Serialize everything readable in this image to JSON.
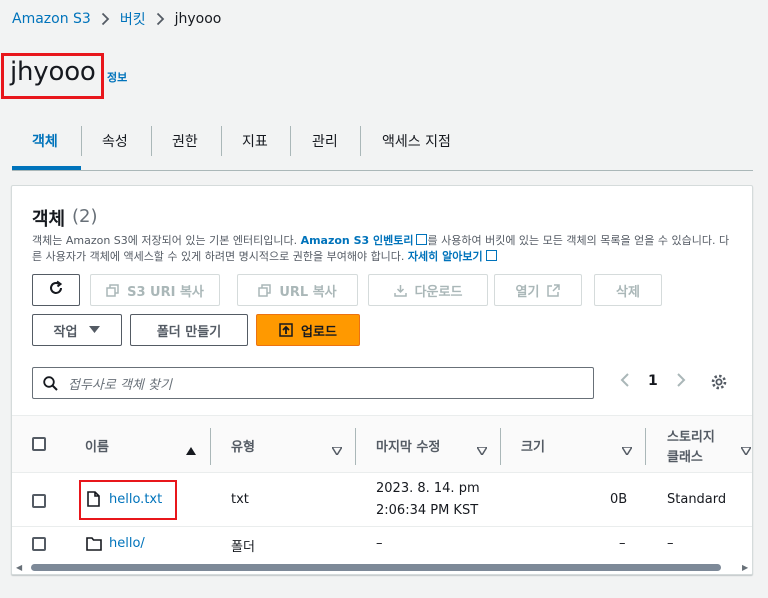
{
  "breadcrumb": {
    "root": "Amazon S3",
    "mid": "버킷",
    "current": "jhyooo"
  },
  "header": {
    "title": "jhyooo",
    "info": "정보"
  },
  "tabs": [
    "객체",
    "속성",
    "권한",
    "지표",
    "관리",
    "액세스 지점"
  ],
  "panel": {
    "title": "객체",
    "count": "(2)",
    "desc_1": "객체는 Amazon S3에 저장되어 있는 기본 엔터티입니다.",
    "desc_link_1": "Amazon S3 인벤토리",
    "desc_2": "를 사용하여 버킷에 있는 모든 객체의 목록을 얻을 수 있습니다. 다른 사용자가 객체에 액세스할 수 있게 하려면 명시적으로 권한을 부여해야 합니다.",
    "desc_link_2": "자세히 알아보기"
  },
  "toolbar": {
    "copy_s3_uri": "S3 URI 복사",
    "copy_url": "URL 복사",
    "download": "다운로드",
    "open": "열기",
    "delete": "삭제",
    "actions": "작업",
    "create_folder": "폴더 만들기",
    "upload": "업로드"
  },
  "search": {
    "placeholder": "접두사로 객체 찾기"
  },
  "pagination": {
    "page": "1"
  },
  "table": {
    "headers": {
      "name": "이름",
      "type": "유형",
      "modified": "마지막 수정",
      "size": "크기",
      "storage_1": "스토리지",
      "storage_2": "클래스"
    },
    "rows": [
      {
        "name": "hello.txt",
        "icon": "file-icon",
        "type": "txt",
        "modified_1": "2023. 8. 14. pm",
        "modified_2": "2:06:34 PM KST",
        "size": "0B",
        "storage": "Standard"
      },
      {
        "name": "hello/",
        "icon": "folder-icon",
        "type": "폴더",
        "modified_1": "–",
        "size": "–",
        "storage": "–"
      }
    ]
  },
  "colors": {
    "link": "#0073bb",
    "primary": "#ff9900",
    "highlight": "#e8161b"
  }
}
